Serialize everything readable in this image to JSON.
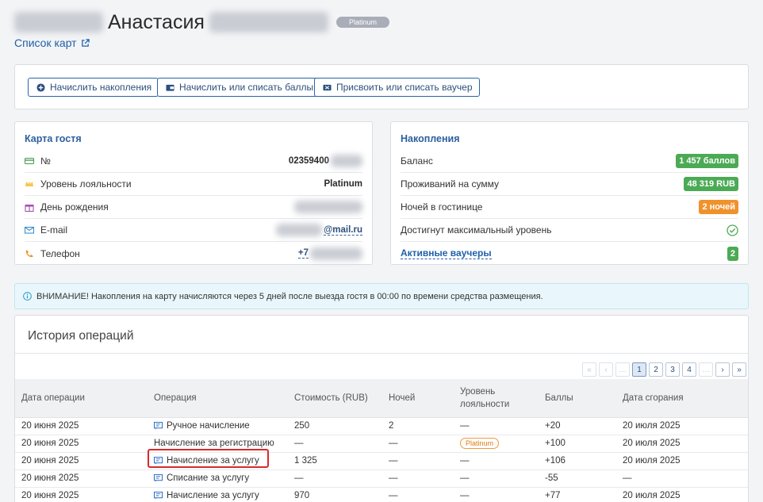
{
  "header": {
    "guest_first_name": "Анастасия",
    "tier_badge": "Platinum",
    "cards_link": "Список карт"
  },
  "actions": {
    "accrue_label": "Начислить накопления",
    "points_label": "Начислить или списать баллы",
    "voucher_label": "Присвоить или списать ваучер"
  },
  "guest_card": {
    "title": "Карта гостя",
    "rows": [
      {
        "label": "№",
        "icon": "card-icon",
        "value": "02359400"
      },
      {
        "label": "Уровень лояльности",
        "icon": "crown-icon",
        "value": "Platinum"
      },
      {
        "label": "День рождения",
        "icon": "gift-icon",
        "value": ""
      },
      {
        "label": "E-mail",
        "icon": "envelope-icon",
        "value": "@mail.ru"
      },
      {
        "label": "Телефон",
        "icon": "phone-icon",
        "value": "+7"
      }
    ]
  },
  "savings": {
    "title": "Накопления",
    "rows": [
      {
        "label": "Баланс",
        "value": "1 457 баллов",
        "color": "#4caa55"
      },
      {
        "label": "Проживаний на сумму",
        "value": "48 319 RUB",
        "color": "#4caa55"
      },
      {
        "label": "Ночей в гостинице",
        "value": "2 ночей",
        "color": "#f0922c"
      },
      {
        "label": "Достигнут максимальный уровень",
        "icon": "check-circle-icon"
      },
      {
        "label": "Активные ваучеры",
        "value": "2",
        "color": "#4caa55"
      }
    ]
  },
  "notice": "ВНИМАНИЕ! Накопления на карту начисляются через 5 дней после выезда гостя в 00:00 по времени средства размещения.",
  "history": {
    "title": "История операций",
    "pager": [
      "«",
      "‹",
      "…",
      "1",
      "2",
      "3",
      "4",
      "…",
      "›",
      "»"
    ],
    "columns": [
      "Дата операции",
      "Операция",
      "Стоимость (RUB)",
      "Ночей",
      "Уровень лояльности",
      "Баллы",
      "Дата сгорания"
    ],
    "rows": [
      {
        "date": "20 июня 2025",
        "op": "Ручное начисление",
        "icon": true,
        "cost": "250",
        "nights": "2",
        "tier": "—",
        "points": "+20",
        "expiry": "20 июля 2025"
      },
      {
        "date": "20 июня 2025",
        "op": "Начисление за регистрацию",
        "icon": false,
        "cost": "—",
        "nights": "—",
        "tier": "Platinum",
        "points": "+100",
        "expiry": "20 июля 2025"
      },
      {
        "date": "20 июня 2025",
        "op": "Начисление за услугу",
        "icon": true,
        "cost": "1 325",
        "nights": "—",
        "tier": "—",
        "points": "+106",
        "expiry": "20 июля 2025"
      },
      {
        "date": "20 июня 2025",
        "op": "Списание за услугу",
        "icon": true,
        "cost": "—",
        "nights": "—",
        "tier": "—",
        "points": "-55",
        "expiry": "—"
      },
      {
        "date": "20 июня 2025",
        "op": "Начисление за услугу",
        "icon": true,
        "cost": "970",
        "nights": "—",
        "tier": "—",
        "points": "+77",
        "expiry": "20 июля 2025"
      }
    ]
  },
  "colors": {
    "accent": "#2b64a8",
    "success": "#4caa55",
    "warning": "#f0922c",
    "highlight": "#d92a2a"
  }
}
